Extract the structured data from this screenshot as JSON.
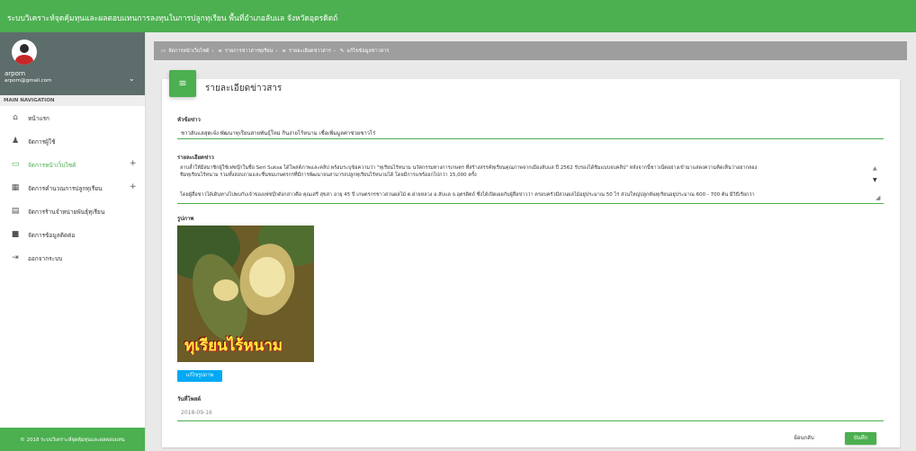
{
  "app": {
    "title": "ระบบวิเคราะห์จุดคุ้มทุนและผลตอบแทนการลงทุนในการปลูกทุเรียน พื้นที่อำเภอลับแล จังหวัดอุตรดิตถ์"
  },
  "user": {
    "name": "arporn",
    "email": "arporn@gmail.com"
  },
  "sidebar": {
    "header": "MAIN NAVIGATION",
    "items": [
      {
        "label": "หน้าแรก",
        "icon": "home-icon"
      },
      {
        "label": "จัดการผู้ใช้",
        "icon": "person-icon"
      },
      {
        "label": "จัดการหน้าเว็บไซต์",
        "icon": "web-icon",
        "active": true,
        "expandable": "+"
      },
      {
        "label": "จัดการคำนวณการปลูกทุเรียน",
        "icon": "calculator-icon",
        "expandable": "+"
      },
      {
        "label": "จัดการร้านจำหน่ายพันธุ์ทุเรียน",
        "icon": "store-icon"
      },
      {
        "label": "จัดการข้อมูลติดต่อ",
        "icon": "contact-icon"
      },
      {
        "label": "ออกจากระบบ",
        "icon": "logout-icon"
      }
    ],
    "footer": "© 2018 ระบบวิเคราะห์จุดคุ้มทุนและผลตอบแทน"
  },
  "breadcrumb": [
    "จัดการหน้าเว็บไซต์",
    "รายการข่าวสารทุเรียน",
    "รายละเอียดข่าวสาร",
    "แก้ไขข้อมูลข่าวสาร"
  ],
  "card": {
    "title": "รายละเอียดข่าวสาร"
  },
  "form": {
    "headline_label": "หัวข้อข่าว",
    "headline_value": "ชาวลับแลสุดเจ๋ง พัฒนาทุเรียนสายพันธุ์ใหม่ กินง่ายไร้หนาม เชื่อเพิ่มมูลค่าช่วยชาวไร่",
    "detail_label": "รายละเอียดข่าว",
    "detail_line1": "ลาบล้ำให้มีสมาชิกผู้ใช้เฟซบุ๊กในชื่อ Seri Suksa ได้โพสต์ภาพและคลิป พร้อมระบุข้อความว่า \"ทุเรียนไร้หนาม นวัตกรรมทางการเกษตร ที่สร้างสรรค์ทุเรียนคุณภาพจากเมืองลับแล ปี 2562 รับรองได้ชิมแบบจบคลิป\" หลังจากนี้ชาวเน็ตอย่างเข้ามาแสดงความคิดเห็นว่าอยากลอง",
    "detail_line2": "ชิมทุเรียนไร้หนาม รวมทั้งสอบถามและชื่นชมเกษตรกรที่มีการพัฒนาจนสามารถปลูกทุเรียนไร้หนามได้ โดยมีการแชร์ออกไปกว่า 15,000 ครั้ง",
    "detail_line3": "โดยผู้สื่อข่าวได้เดินทางไปพบกับเจ้าของเฟซบุ๊กดังกล่าวคือ คุณเสรี สุขสา อายุ 45 ปี เกษตรกรชาวสวนผลไม้ ต.ฝายหลวง อ.ลับแล จ.อุตรดิตถ์ ซึ่งได้เปิดเผยกับผู้สื่อข่าวว่า ครอบครัวมีสวนผลไม้อยู่ประมาณ 50 ไร่ ส่วนใหญ่ปลูกต้นทุเรียนอยู่ประมาณ 600 - 700 ต้น มีวิธีเรียกว่า",
    "image_label": "รูปภาพ",
    "image_caption": "ทุเรียนไร้หนาม",
    "edit_image_label": "แก้ไขรูปภาพ",
    "date_label": "วันที่โพสต์",
    "date_value": "2018-09-16"
  },
  "actions": {
    "back_label": "ย้อนกลับ",
    "save_label": "บันทึก"
  },
  "colors": {
    "primary": "#4caf50",
    "info": "#03a9f4",
    "breadcrumb_bg": "#9e9e9e"
  }
}
